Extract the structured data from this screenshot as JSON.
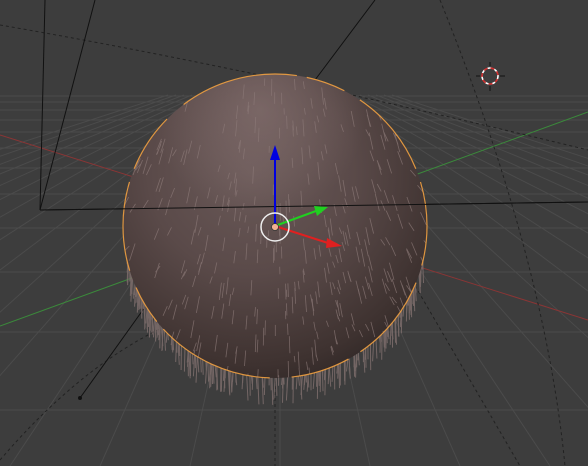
{
  "viewport": {
    "mode": "3d-viewport",
    "background_color": "#3d3d3d",
    "grid_color": "#4a4a4a",
    "x_axis_color": "#9a3030",
    "y_axis_color": "#3a8a3a"
  },
  "selected_object": {
    "type": "sphere",
    "has_hair_particles": true,
    "surface_color": "#6e5c5a",
    "outline_color": "#f0a040"
  },
  "gizmo": {
    "z_color": "#0000e0",
    "y_color": "#20d020",
    "x_color": "#e02020",
    "pivot_color": "#f0b090"
  },
  "camera_icon": "camera-wireframe-icon",
  "light_icon": "light-lamp-icon",
  "cursor_icon": "3d-cursor-icon"
}
